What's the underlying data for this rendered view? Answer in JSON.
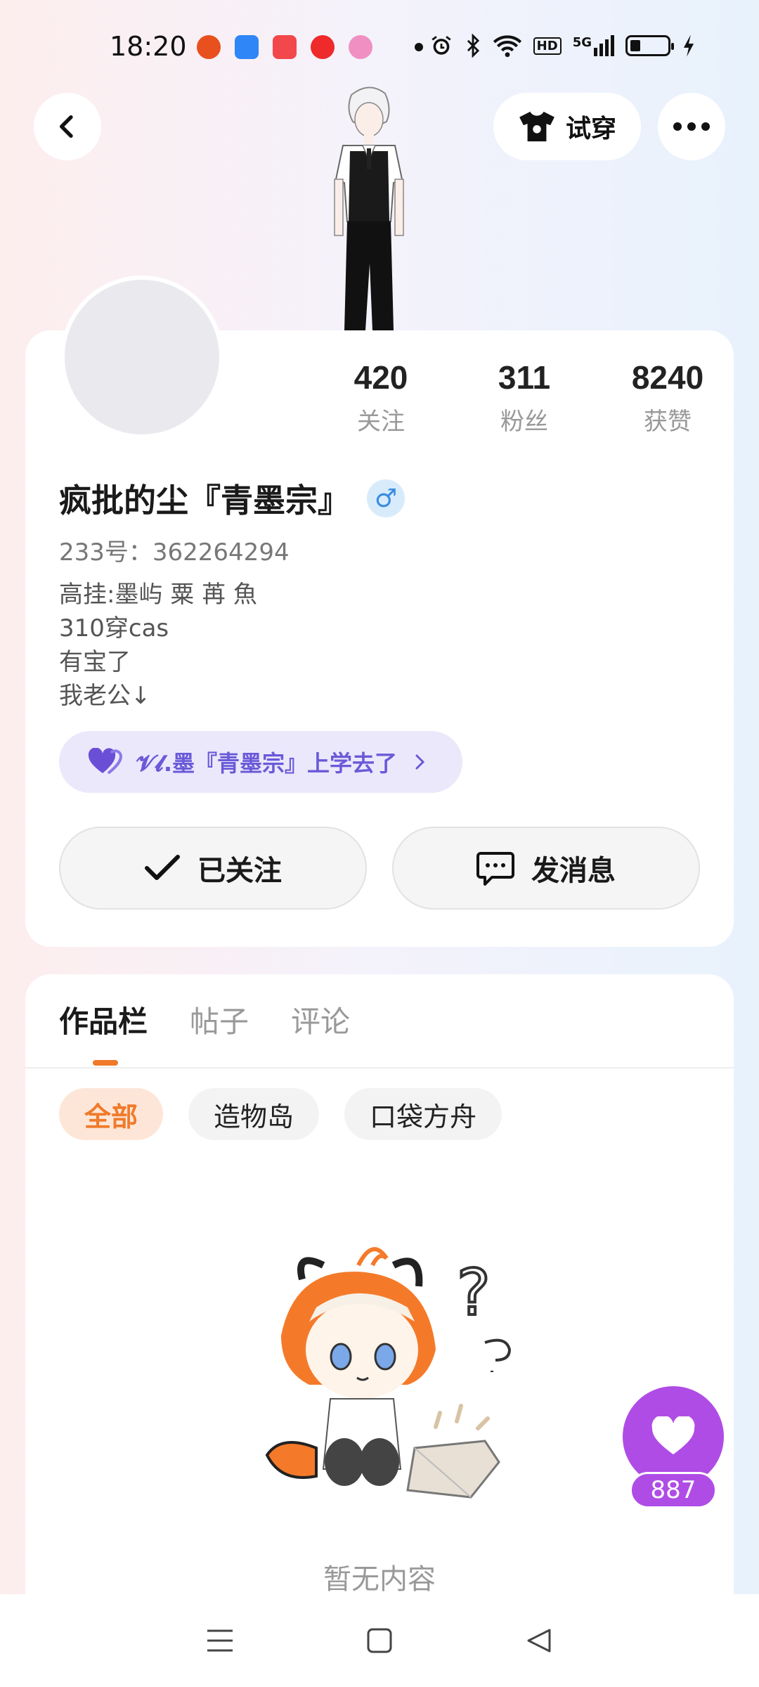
{
  "status_bar": {
    "time": "18:20",
    "icons": [
      "app-weibo-icon",
      "app-lark-icon",
      "app-kuaishou-icon",
      "app-video-icon",
      "app-flower-icon",
      "dot-icon",
      "alarm-icon",
      "bluetooth-icon",
      "wifi-icon",
      "hd-icon",
      "5g-signal-icon",
      "battery-icon",
      "charging-icon"
    ],
    "hd_label": "HD",
    "network_label": "5G"
  },
  "header": {
    "tryon_label": "试穿"
  },
  "profile": {
    "stats": [
      {
        "value": "420",
        "label": "关注"
      },
      {
        "value": "311",
        "label": "粉丝"
      },
      {
        "value": "8240",
        "label": "获赞"
      }
    ],
    "username": "疯批的尘『青墨宗』",
    "gender_symbol": "♂",
    "uid": "233号：362264294",
    "bio_lines": [
      "高挂:墨屿  粟 苒  魚",
      "310穿cas",
      "有宝了",
      "我老公↓"
    ],
    "relation_text": "𝓥𝓵.墨『青墨宗』上学去了"
  },
  "actions": {
    "follow_label": "已关注",
    "message_label": "发消息"
  },
  "works": {
    "tabs": [
      "作品栏",
      "帖子",
      "评论"
    ],
    "chips": [
      "全部",
      "造物岛",
      "口袋方舟"
    ],
    "empty_text": "暂无内容"
  },
  "like_fab": {
    "count": "887"
  },
  "colors": {
    "accent_orange": "#f07a2a",
    "accent_purple": "#b04ce6",
    "relation_purple": "#6a5ad8"
  }
}
